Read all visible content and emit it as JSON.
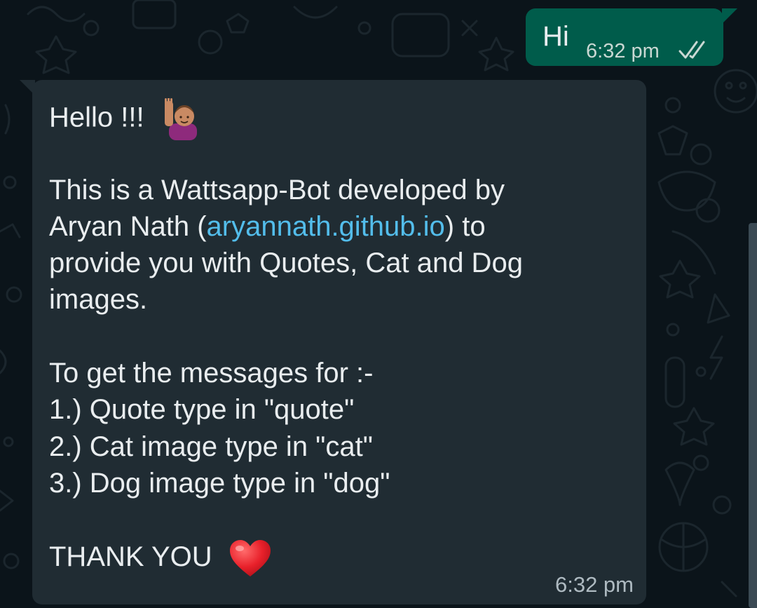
{
  "outgoing": {
    "text": "Hi",
    "time": "6:32 pm",
    "status_icon": "double-check-icon"
  },
  "incoming": {
    "greeting": "Hello !!!",
    "greeting_emoji": "raising-hand-emoji",
    "intro_1": "This is a Wattsapp-Bot developed by",
    "intro_2_prefix": "Aryan Nath (",
    "intro_2_link": "aryannath.github.io",
    "intro_2_suffix": ") to",
    "intro_3": "provide you with Quotes, Cat and Dog",
    "intro_4": "images.",
    "instr_header": "To get the messages for :-",
    "instr_1": "1.) Quote type in \"quote\"",
    "instr_2": "2.) Cat image type in \"cat\"",
    "instr_3": "3.) Dog image type in \"dog\"",
    "thanks": "THANK YOU",
    "thanks_emoji": "red-heart-emoji",
    "time": "6:32 pm"
  },
  "colors": {
    "background": "#0b141a",
    "outgoing_bubble": "#005c4b",
    "incoming_bubble": "#202c33",
    "link": "#53bdeb",
    "read_ticks": "#c9d8d3",
    "text": "#e9edef"
  }
}
